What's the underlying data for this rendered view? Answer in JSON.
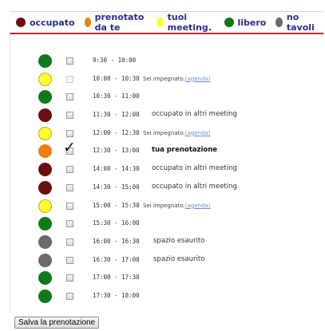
{
  "legend": [
    {
      "label": "occupato",
      "color": "#6b0f0f"
    },
    {
      "label": "prenotato da te",
      "color": "#f07b14"
    },
    {
      "label": "tuoi meeting.",
      "color": "#ffff33"
    },
    {
      "label": "libero",
      "color": "#0f7a1a"
    },
    {
      "label": "no tavoli",
      "color": "#6a6a6a"
    }
  ],
  "slots": [
    {
      "time": "9:30 - 10:00",
      "color": "#0f7a1a",
      "status": "",
      "style": "plain",
      "checkbox": "enabled"
    },
    {
      "time": "10:00 - 10:30",
      "color": "#ffff33",
      "status": "Sei impegnato.",
      "link": "(agenda)",
      "style": "small",
      "checkbox": "disabled"
    },
    {
      "time": "10:30 - 11:00",
      "color": "#0f7a1a",
      "status": "",
      "style": "plain",
      "checkbox": "enabled"
    },
    {
      "time": "11:30 - 12:00",
      "color": "#6b0f0f",
      "status": "occupato in altri meeting",
      "style": "plain",
      "checkbox": "enabled"
    },
    {
      "time": "12:00 - 12:30",
      "color": "#ffff33",
      "status": "Sei impegnato.",
      "link": "(agenda)",
      "style": "small",
      "checkbox": "enabled"
    },
    {
      "time": "12:30 - 13:00",
      "color": "#f07b14",
      "status": "tua prenotazione",
      "style": "bold",
      "checkbox": "checked"
    },
    {
      "time": "14:00 - 14:30",
      "color": "#6b0f0f",
      "status": "occupato in altri meeting",
      "style": "plain",
      "checkbox": "enabled"
    },
    {
      "time": "14:30 - 15:00",
      "color": "#6b0f0f",
      "status": "occupato in altri meeting",
      "style": "plain",
      "checkbox": "enabled"
    },
    {
      "time": "15:00 - 15:30",
      "color": "#ffff33",
      "status": "Sei impegnato.",
      "link": "(agenda)",
      "style": "small",
      "checkbox": "enabled"
    },
    {
      "time": "15:30 - 16:00",
      "color": "#0f7a1a",
      "status": "",
      "style": "plain",
      "checkbox": "enabled"
    },
    {
      "time": "16:00 - 16:30",
      "color": "#6a6a6a",
      "status": "spazio esaurito",
      "style": "plain",
      "checkbox": "enabled"
    },
    {
      "time": "16:30 - 17:00",
      "color": "#6a6a6a",
      "status": "spazio esaurito",
      "style": "plain",
      "checkbox": "enabled"
    },
    {
      "time": "17:00 - 17:30",
      "color": "#0f7a1a",
      "status": "",
      "style": "plain",
      "checkbox": "enabled"
    },
    {
      "time": "17:30 - 18:00",
      "color": "#0f7a1a",
      "status": "",
      "style": "plain",
      "checkbox": "enabled"
    }
  ],
  "save_button": "Salva la prenotazione"
}
